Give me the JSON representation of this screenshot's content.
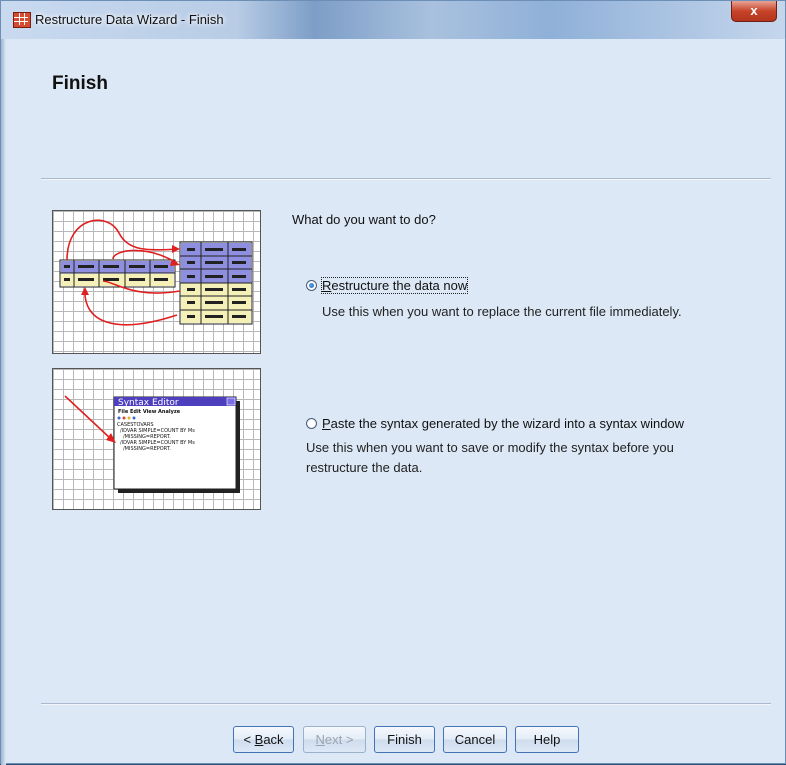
{
  "window": {
    "title": "Restructure Data Wizard - Finish",
    "close_glyph": "x"
  },
  "page": {
    "heading": "Finish",
    "question": "What do you want to do?"
  },
  "options": [
    {
      "label_key": "R",
      "label_rest": "estructure the data now",
      "description": "Use this when you want to replace the current file immediately.",
      "selected": true
    },
    {
      "label_key": "P",
      "label_rest": "aste the syntax generated by the wizard into a syntax window",
      "description_line1": "Use this when you want to save or modify the syntax before you",
      "description_line2": "restructure the data.",
      "selected": false
    }
  ],
  "illustration_syntax": {
    "editor_title": "Syntax Editor",
    "menu": "File Edit View Analyze",
    "lines": [
      "CASESTOVARS",
      "/IDVAR SIMPLE=COUNT BY Ms",
      "/MISSING=REPORT.",
      "/IDVAR SIMPLE=COUNT BY Ms",
      "/MISSING=REPORT."
    ]
  },
  "buttons": {
    "back_prefix": "< ",
    "back_key": "B",
    "back_rest": "ack",
    "next_key": "N",
    "next_rest": "ext >",
    "finish": "Finish",
    "cancel": "Cancel",
    "help": "Help"
  },
  "colors": {
    "dialog_bg": "#dce8f5",
    "arrow_red": "#e02020",
    "table_header": "#8f8fe0",
    "table_cell": "#f4f0b8"
  }
}
